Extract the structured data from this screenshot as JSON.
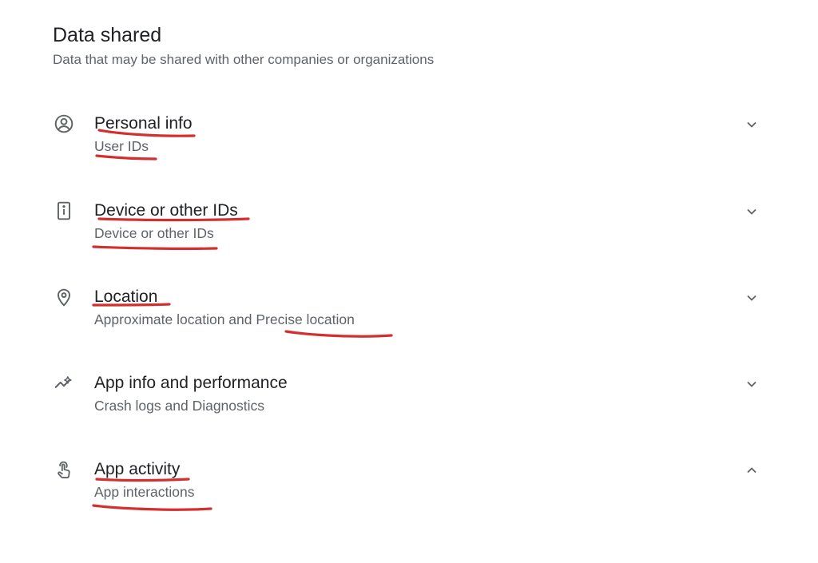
{
  "section": {
    "title": "Data shared",
    "subtitle": "Data that may be shared with other companies or organizations"
  },
  "items": [
    {
      "icon": "account-circle-icon",
      "title": "Personal info",
      "description": "User IDs",
      "chevron": "chevron-down-icon"
    },
    {
      "icon": "device-id-icon",
      "title": "Device or other IDs",
      "description": "Device or other IDs",
      "chevron": "chevron-down-icon"
    },
    {
      "icon": "location-pin-icon",
      "title": "Location",
      "description": "Approximate location and Precise location",
      "chevron": "chevron-down-icon"
    },
    {
      "icon": "app-performance-icon",
      "title": "App info and performance",
      "description": "Crash logs and Diagnostics",
      "chevron": "chevron-down-icon"
    },
    {
      "icon": "touch-hand-icon",
      "title": "App activity",
      "description": "App interactions",
      "chevron": "chevron-up-icon"
    }
  ],
  "colors": {
    "text_primary": "#202124",
    "text_secondary": "#5f6368",
    "icon": "#5f6368",
    "annotation": "#d32f2f"
  }
}
